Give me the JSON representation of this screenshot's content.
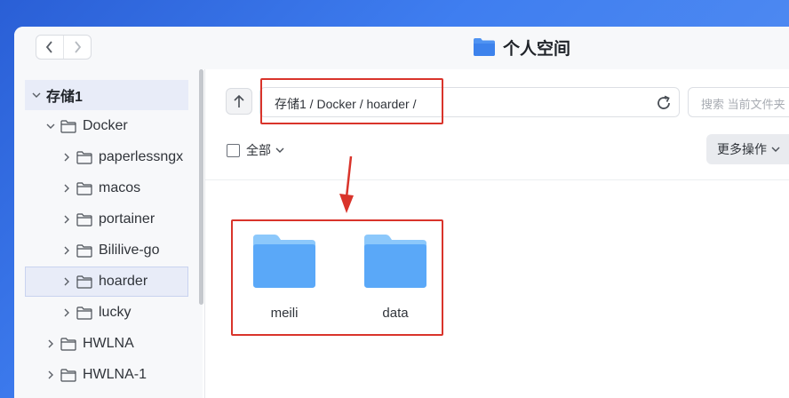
{
  "window": {
    "title": "个人空间",
    "title_icon": "folder-icon"
  },
  "sidebar": {
    "items": [
      {
        "label": "存储1",
        "level": 0,
        "expanded": true
      },
      {
        "label": "Docker",
        "level": 1,
        "expanded": true
      },
      {
        "label": "paperlessngx",
        "level": 2,
        "expanded": false
      },
      {
        "label": "macos",
        "level": 2,
        "expanded": false
      },
      {
        "label": "portainer",
        "level": 2,
        "expanded": false
      },
      {
        "label": "Bililive-go",
        "level": 2,
        "expanded": false
      },
      {
        "label": "hoarder",
        "level": 2,
        "expanded": false,
        "selected": true
      },
      {
        "label": "lucky",
        "level": 2,
        "expanded": false
      },
      {
        "label": "HWLNA",
        "level": 1,
        "expanded": false
      },
      {
        "label": "HWLNA-1",
        "level": 1,
        "expanded": false
      }
    ]
  },
  "toolbar": {
    "path": "存储1 / Docker / hoarder /",
    "search_placeholder": "搜索 当前文件夹",
    "select_all_label": "全部",
    "more_actions_label": "更多操作"
  },
  "files": [
    {
      "name": "meili",
      "type": "folder"
    },
    {
      "name": "data",
      "type": "folder"
    }
  ],
  "colors": {
    "annotation": "#d9342b",
    "folder": "#5aa8f8",
    "selected_bg": "#e8ecf8"
  }
}
